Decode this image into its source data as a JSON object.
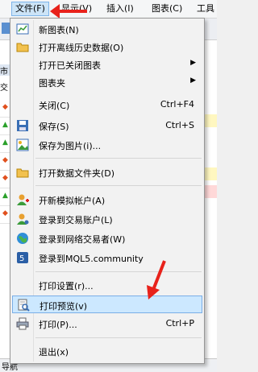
{
  "menubar": {
    "items": [
      {
        "label": "文件(F)"
      },
      {
        "label": "显示(V)"
      },
      {
        "label": "插入(I)"
      },
      {
        "label": "图表(C)"
      },
      {
        "label": "工具"
      }
    ]
  },
  "background": {
    "fragment_left_top": "市场",
    "fragment_left_2": "交",
    "fragment_bottom": "导航"
  },
  "menu": {
    "items": [
      {
        "label": "新图表(N)",
        "shortcut": "",
        "icon": "new-chart-icon"
      },
      {
        "label": "打开离线历史数据(O)",
        "shortcut": "",
        "icon": "open-folder-icon"
      },
      {
        "label": "打开已关闭图表",
        "shortcut": "",
        "icon": "",
        "submenu": true
      },
      {
        "label": "图表夹",
        "shortcut": "",
        "icon": "",
        "submenu": true
      },
      {
        "label": "关闭(C)",
        "shortcut": "Ctrl+F4",
        "icon": ""
      },
      {
        "label": "保存(S)",
        "shortcut": "Ctrl+S",
        "icon": "save-icon"
      },
      {
        "label": "保存为图片(i)...",
        "shortcut": "",
        "icon": "save-picture-icon"
      },
      {
        "label": "打开数据文件夹(D)",
        "shortcut": "",
        "icon": "folder-icon"
      },
      {
        "label": "开新模拟帐户(A)",
        "shortcut": "",
        "icon": "new-account-icon"
      },
      {
        "label": "登录到交易账户(L)",
        "shortcut": "",
        "icon": "login-account-icon"
      },
      {
        "label": "登录到网络交易者(W)",
        "shortcut": "",
        "icon": "web-trader-icon"
      },
      {
        "label": "登录到MQL5.community",
        "shortcut": "",
        "icon": "mql5-icon"
      },
      {
        "label": "打印设置(r)...",
        "shortcut": "",
        "icon": ""
      },
      {
        "label": "打印预览(v)",
        "shortcut": "",
        "icon": "print-preview-icon"
      },
      {
        "label": "打印(P)...",
        "shortcut": "Ctrl+P",
        "icon": "print-icon"
      },
      {
        "label": "退出(x)",
        "shortcut": "",
        "icon": ""
      }
    ]
  },
  "colors": {
    "highlight": "#cce8ff",
    "annotation_arrow": "#e8221b"
  }
}
